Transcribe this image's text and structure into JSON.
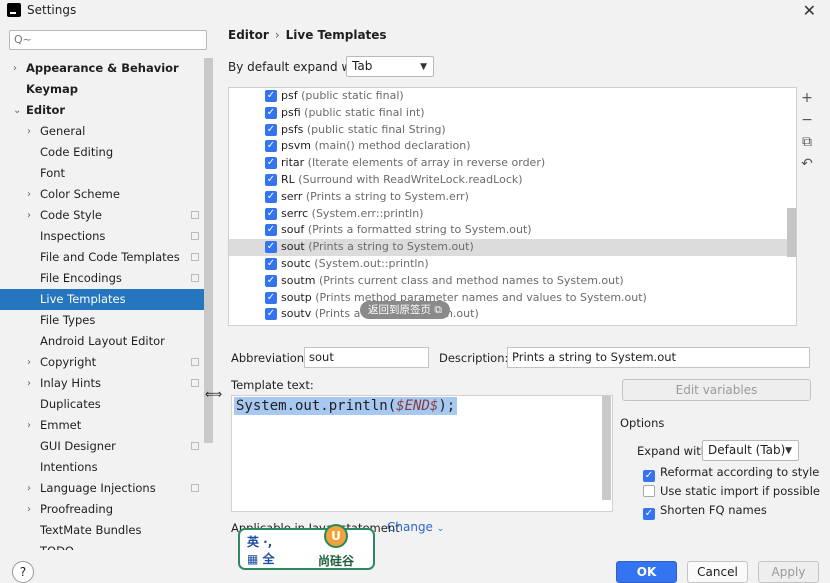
{
  "window": {
    "title": "Settings",
    "close_icon": "close-icon"
  },
  "search": {
    "placeholder": "Q~"
  },
  "tree": [
    {
      "label": "Appearance & Behavior",
      "bold": true,
      "arrow": true,
      "indent": 0
    },
    {
      "label": "Keymap",
      "bold": true,
      "arrow": false,
      "indent": 0
    },
    {
      "label": "Editor",
      "bold": true,
      "arrow": "down",
      "indent": 0
    },
    {
      "label": "General",
      "arrow": true,
      "indent": 1
    },
    {
      "label": "Code Editing",
      "indent": 1
    },
    {
      "label": "Font",
      "indent": 1
    },
    {
      "label": "Color Scheme",
      "arrow": true,
      "indent": 1
    },
    {
      "label": "Code Style",
      "arrow": true,
      "indent": 1,
      "copy": true
    },
    {
      "label": "Inspections",
      "indent": 1,
      "copy": true
    },
    {
      "label": "File and Code Templates",
      "indent": 1,
      "copy": true
    },
    {
      "label": "File Encodings",
      "indent": 1,
      "copy": true
    },
    {
      "label": "Live Templates",
      "indent": 1,
      "selected": true
    },
    {
      "label": "File Types",
      "indent": 1
    },
    {
      "label": "Android Layout Editor",
      "indent": 1
    },
    {
      "label": "Copyright",
      "arrow": true,
      "indent": 1,
      "copy": true
    },
    {
      "label": "Inlay Hints",
      "arrow": true,
      "indent": 1,
      "copy": true
    },
    {
      "label": "Duplicates",
      "indent": 1
    },
    {
      "label": "Emmet",
      "arrow": true,
      "indent": 1
    },
    {
      "label": "GUI Designer",
      "indent": 1,
      "copy": true
    },
    {
      "label": "Intentions",
      "indent": 1
    },
    {
      "label": "Language Injections",
      "arrow": true,
      "indent": 1,
      "copy": true
    },
    {
      "label": "Proofreading",
      "arrow": true,
      "indent": 1
    },
    {
      "label": "TextMate Bundles",
      "indent": 1
    },
    {
      "label": "TODO",
      "indent": 1
    }
  ],
  "breadcrumb": {
    "part1": "Editor",
    "sep": "›",
    "part2": "Live Templates"
  },
  "expand": {
    "label": "By default expand with",
    "value": "Tab"
  },
  "templates": [
    {
      "abbr": "psf",
      "desc": "(public static final)"
    },
    {
      "abbr": "psfi",
      "desc": "(public static final int)"
    },
    {
      "abbr": "psfs",
      "desc": "(public static final String)"
    },
    {
      "abbr": "psvm",
      "desc": "(main() method declaration)"
    },
    {
      "abbr": "ritar",
      "desc": "(Iterate elements of array in reverse order)"
    },
    {
      "abbr": "RL",
      "desc": "(Surround with ReadWriteLock.readLock)"
    },
    {
      "abbr": "serr",
      "desc": "(Prints a string to System.err)"
    },
    {
      "abbr": "serrc",
      "desc": "(System.err::println)"
    },
    {
      "abbr": "souf",
      "desc": "(Prints a formatted string to System.out)"
    },
    {
      "abbr": "sout",
      "desc": "(Prints a string to System.out)",
      "selected": true
    },
    {
      "abbr": "soutc",
      "desc": "(System.out::println)"
    },
    {
      "abbr": "soutm",
      "desc": "(Prints current class and method names to System.out)"
    },
    {
      "abbr": "soutp",
      "desc": "(Prints method parameter names and values to System.out)"
    },
    {
      "abbr": "soutv",
      "desc": "(Prints a value to System.out)"
    }
  ],
  "tools": [
    "+",
    "−",
    "⧉",
    "↶"
  ],
  "overlay_tip": "返回到原签页  ⧉",
  "abbreviation": {
    "label": "Abbreviation:",
    "value": "sout"
  },
  "description": {
    "label": "Description:",
    "value": "Prints a string to System.out"
  },
  "template_text": {
    "label": "Template text:",
    "code_prefix": "System.out.println(",
    "code_var": "$END$",
    "code_suffix": ");"
  },
  "edit_variables": "Edit variables",
  "options": {
    "title": "Options",
    "expand_label": "Expand with",
    "expand_value": "Default (Tab)",
    "reformat": "Reformat according to style",
    "static_import": "Use static import if possible",
    "shorten_fq": "Shorten FQ names"
  },
  "applicable": {
    "text": "Applicable in Java: statement",
    "change": "Change"
  },
  "buttons": {
    "ok": "OK",
    "cancel": "Cancel",
    "apply": "Apply",
    "help": "?"
  },
  "ime": {
    "line1": "英 ·, ",
    "line2": "▦ 全",
    "brand": "尚硅谷",
    "logo": "U"
  }
}
